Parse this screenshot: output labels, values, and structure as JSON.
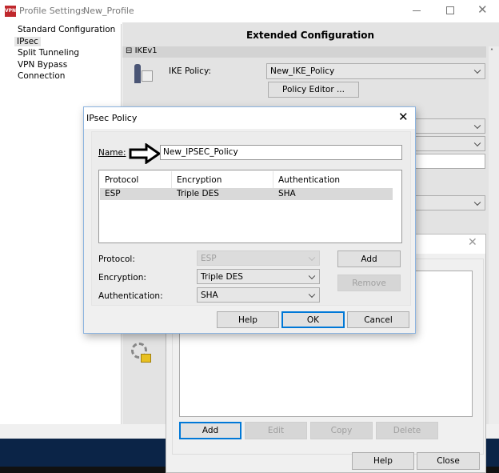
{
  "main_window": {
    "title": "Profile Settings",
    "profile": "New_Profile",
    "app_icon": "VPN",
    "nav": [
      "Standard Configuration",
      "IPsec",
      "Split Tunneling",
      "VPN Bypass",
      "Connection"
    ],
    "header": "Extended Configuration",
    "section": "IKEv1",
    "ike_policy_label": "IKE Policy:",
    "ike_policy_value": "New_IKE_Policy",
    "policy_editor_button": "Policy Editor ..."
  },
  "policy_window": {
    "add": "Add",
    "edit": "Edit",
    "copy": "Copy",
    "delete": "Delete",
    "help": "Help",
    "close": "Close"
  },
  "dialog": {
    "title": "IPsec Policy",
    "name_label": "Name:",
    "name_value": "New_IPSEC_Policy",
    "columns": [
      "Protocol",
      "Encryption",
      "Authentication"
    ],
    "rows": [
      [
        "ESP",
        "Triple DES",
        "SHA"
      ]
    ],
    "protocol_label": "Protocol:",
    "protocol_value": "ESP",
    "encryption_label": "Encryption:",
    "encryption_value": "Triple DES",
    "authentication_label": "Authentication:",
    "authentication_value": "SHA",
    "add": "Add",
    "remove": "Remove",
    "help": "Help",
    "ok": "OK",
    "cancel": "Cancel"
  },
  "colors": {
    "accent": "#0078d7",
    "taskbar": "#0b2447"
  }
}
